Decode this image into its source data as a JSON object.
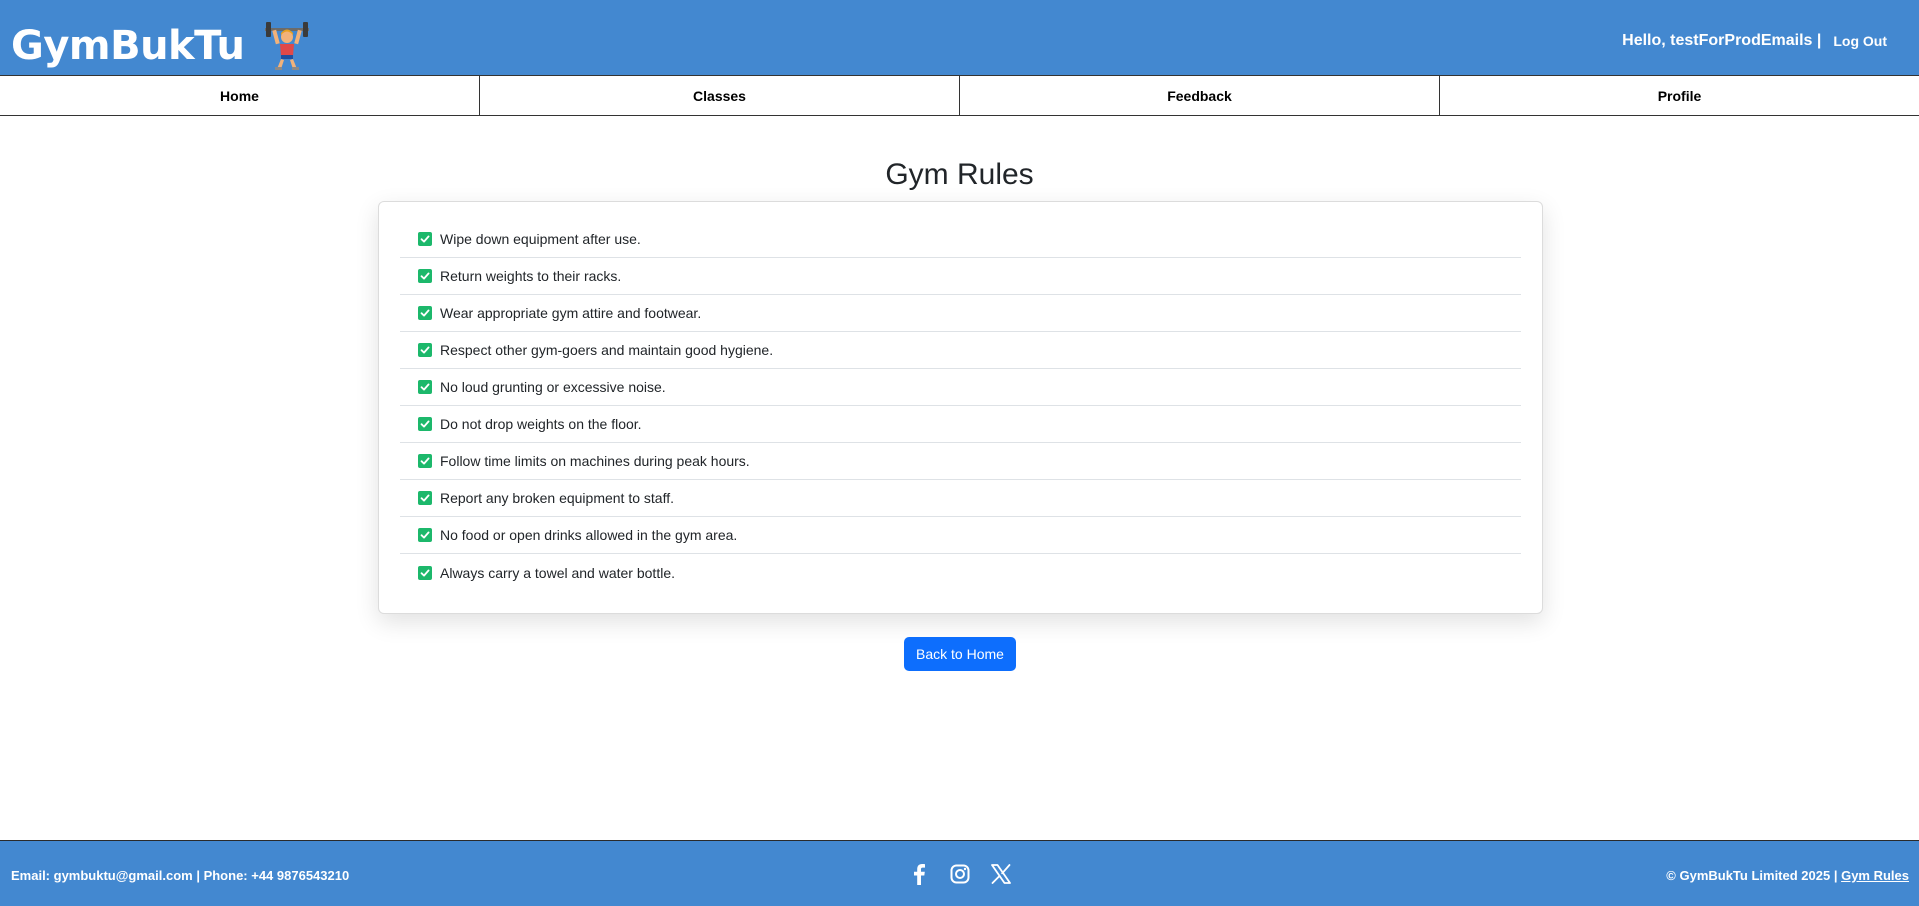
{
  "header": {
    "brand": "GymBukTu",
    "brand_icon": "weightlifter-icon",
    "greeting": "Hello, testForProdEmails |",
    "logout_label": "Log Out"
  },
  "nav": {
    "items": [
      {
        "label": "Home"
      },
      {
        "label": "Classes"
      },
      {
        "label": "Feedback"
      },
      {
        "label": "Profile"
      }
    ]
  },
  "main": {
    "title": "Gym Rules",
    "rules": [
      "Wipe down equipment after use.",
      "Return weights to their racks.",
      "Wear appropriate gym attire and footwear.",
      "Respect other gym-goers and maintain good hygiene.",
      "No loud grunting or excessive noise.",
      "Do not drop weights on the floor.",
      "Follow time limits on machines during peak hours.",
      "Report any broken equipment to staff.",
      "No food or open drinks allowed in the gym area.",
      "Always carry a towel and water bottle."
    ],
    "check_icon": "checkbox-checked-icon",
    "back_button_label": "Back to Home"
  },
  "footer": {
    "contact": "Email: gymbuktu@gmail.com | Phone: +44 9876543210",
    "copyright": "© GymBukTu Limited 2025 | ",
    "rules_link": "Gym Rules",
    "socials": [
      "facebook-icon",
      "instagram-icon",
      "x-icon"
    ]
  },
  "colors": {
    "header_bg": "#4388d0",
    "button": "#0d6efd",
    "check": "#1cb86b"
  }
}
